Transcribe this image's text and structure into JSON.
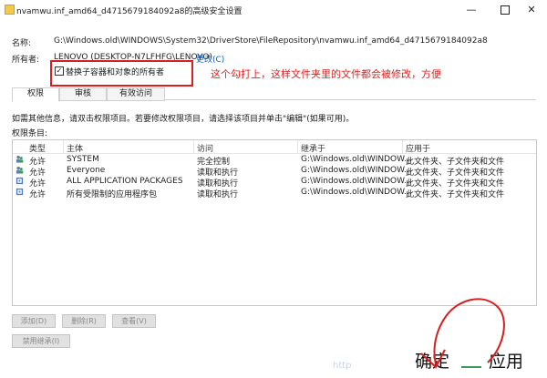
{
  "window": {
    "title": "nvamwu.inf_amd64_d4715679184092a8的高级安全设置",
    "minimize": "—",
    "close": "✕"
  },
  "name_row": {
    "label": "名称:",
    "value": "G:\\Windows.old\\WINDOWS\\System32\\DriverStore\\FileRepository\\nvamwu.inf_amd64_d4715679184092a8"
  },
  "owner_row": {
    "label": "所有者:",
    "value": "LENOVO (DESKTOP-N7LFHFG\\LENOVO)",
    "change_link": "更改(C)"
  },
  "replace_owner": {
    "label": "替换子容器和对象的所有者",
    "checked": true,
    "check_glyph": "✓"
  },
  "annotation": {
    "text": "这个勾打上，这样文件夹里的文件都会被修改，方便",
    "color": "#e02020"
  },
  "tabs": [
    {
      "label": "权限",
      "active": true
    },
    {
      "label": "审核",
      "active": false
    },
    {
      "label": "有效访问",
      "active": false
    }
  ],
  "info_text": "如需其他信息，请双击权限项目。若要修改权限项目，请选择该项目并单击\"编辑\"(如果可用)。",
  "entries_label": "权限条目:",
  "table": {
    "headers": [
      "类型",
      "主体",
      "访问",
      "继承于",
      "应用于"
    ],
    "rows": [
      {
        "icon": "user-group-icon",
        "type": "允许",
        "principal": "SYSTEM",
        "access": "完全控制",
        "inherited": "G:\\Windows.old\\WINDOW...",
        "applies": "此文件夹、子文件夹和文件"
      },
      {
        "icon": "user-group-icon",
        "type": "允许",
        "principal": "Everyone",
        "access": "读取和执行",
        "inherited": "G:\\Windows.old\\WINDOW...",
        "applies": "此文件夹、子文件夹和文件"
      },
      {
        "icon": "package-icon",
        "type": "允许",
        "principal": "ALL APPLICATION PACKAGES",
        "access": "读取和执行",
        "inherited": "G:\\Windows.old\\WINDOW...",
        "applies": "此文件夹、子文件夹和文件"
      },
      {
        "icon": "package-icon",
        "type": "允许",
        "principal": "所有受限制的应用程序包",
        "access": "读取和执行",
        "inherited": "G:\\Windows.old\\WINDOW...",
        "applies": "此文件夹、子文件夹和文件"
      }
    ]
  },
  "buttons": {
    "add": "添加(D)",
    "remove": "删除(R)",
    "view": "查看(V)",
    "disable_inheritance": "禁用继承(I)"
  },
  "footer": {
    "ok": "确定",
    "apply": "应用",
    "watermark": "http"
  }
}
